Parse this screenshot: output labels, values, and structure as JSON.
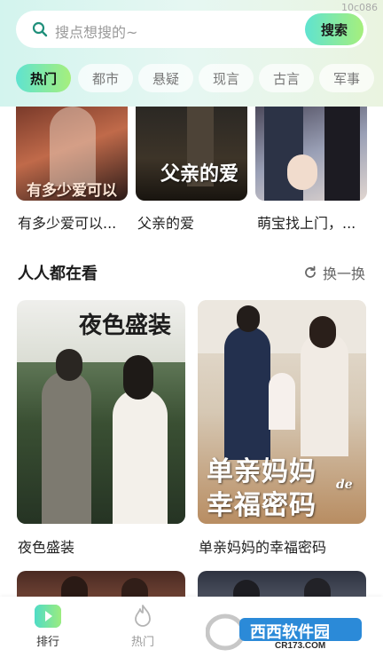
{
  "status": {
    "watermark": "10c086"
  },
  "search": {
    "placeholder": "搜点想搜的~",
    "button_label": "搜索"
  },
  "tabs": [
    {
      "label": "热门",
      "active": true
    },
    {
      "label": "都市",
      "active": false
    },
    {
      "label": "悬疑",
      "active": false
    },
    {
      "label": "现言",
      "active": false
    },
    {
      "label": "古言",
      "active": false
    },
    {
      "label": "军事",
      "active": false
    }
  ],
  "top_row": [
    {
      "title": "有多少爱可以...",
      "cover_text": "有多少爱可以重来"
    },
    {
      "title": "父亲的爱",
      "cover_text": "父亲的爱"
    },
    {
      "title": "萌宝找上门，..."
    }
  ],
  "section": {
    "title": "人人都在看",
    "refresh_label": "换一换"
  },
  "featured": [
    {
      "title": "夜色盛装",
      "cover_text": "夜色盛装",
      "cover_small": "色"
    },
    {
      "title": "单亲妈妈的幸福密码",
      "cover_text_1": "单亲妈妈",
      "cover_text_2": "幸福密码",
      "cover_de": "de"
    }
  ],
  "bottom_nav": [
    {
      "label": "排行",
      "icon": "play-icon",
      "active": true
    },
    {
      "label": "热门",
      "icon": "flame-icon",
      "active": false
    }
  ],
  "watermark_logo": {
    "text": "西西软件园",
    "url_text": "CR173.COM"
  },
  "colors": {
    "accent_start": "#5fe3d0",
    "accent_end": "#a6ef7c"
  }
}
